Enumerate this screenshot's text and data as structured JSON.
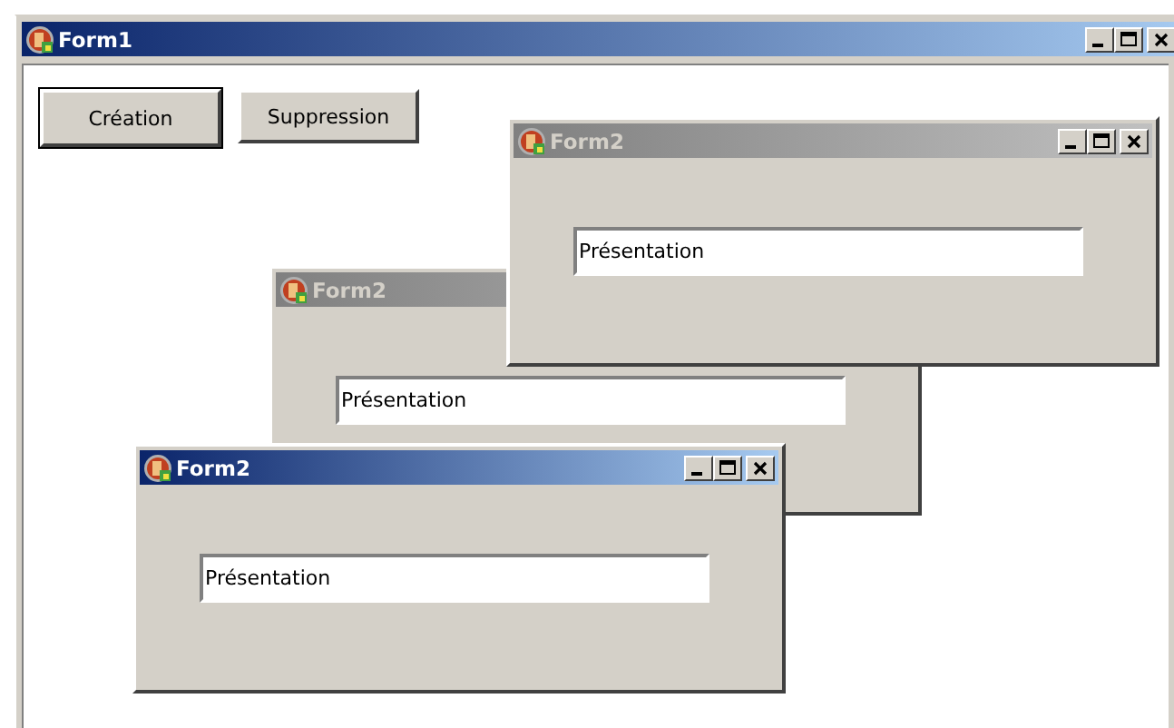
{
  "window": {
    "title": "Form1",
    "active": true,
    "title_buttons": true
  },
  "buttons": [
    {
      "label": "Création",
      "default": true
    },
    {
      "label": "Suppression",
      "default": false
    }
  ],
  "child_windows": [
    {
      "title": "Form2",
      "active": false,
      "title_buttons": true,
      "field": {
        "value": "Présentation"
      }
    },
    {
      "title": "Form2",
      "active": false,
      "title_buttons": false,
      "field": {
        "value": "Présentation"
      }
    },
    {
      "title": "Form2",
      "active": true,
      "title_buttons": true,
      "field": {
        "value": "Présentation"
      }
    }
  ]
}
